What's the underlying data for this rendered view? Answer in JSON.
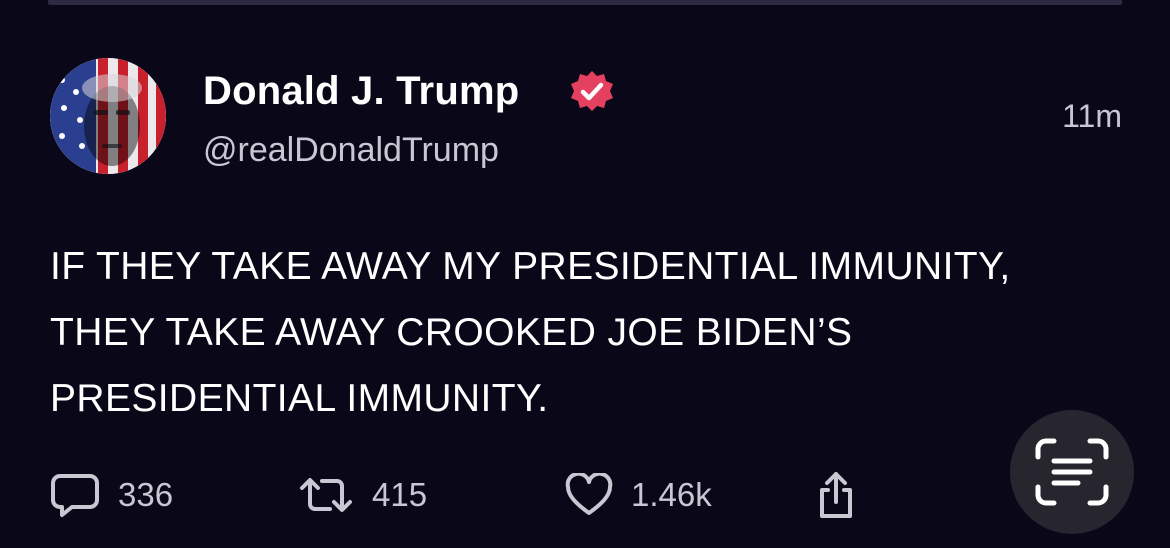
{
  "post": {
    "author": {
      "display_name": "Donald J. Trump",
      "handle": "@realDonaldTrump",
      "verified": true,
      "avatar_icon": "flag-portrait-avatar"
    },
    "timestamp": "11m",
    "text": "IF THEY TAKE AWAY MY PRESIDENTIAL IMMUNITY, THEY TAKE AWAY CROOKED JOE BIDEN’S PRESIDENTIAL IMMUNITY.",
    "actions": {
      "reply": {
        "icon": "reply-icon",
        "count": "336"
      },
      "repost": {
        "icon": "repost-icon",
        "count": "415"
      },
      "like": {
        "icon": "heart-icon",
        "count": "1.46k"
      },
      "share": {
        "icon": "share-icon"
      }
    }
  },
  "overlay": {
    "scan_icon": "text-scan-icon"
  },
  "colors": {
    "background": "#0a0818",
    "verified_badge": "#e4405f",
    "secondary_text": "#c9c7d2",
    "scan_button": "#27252e"
  }
}
